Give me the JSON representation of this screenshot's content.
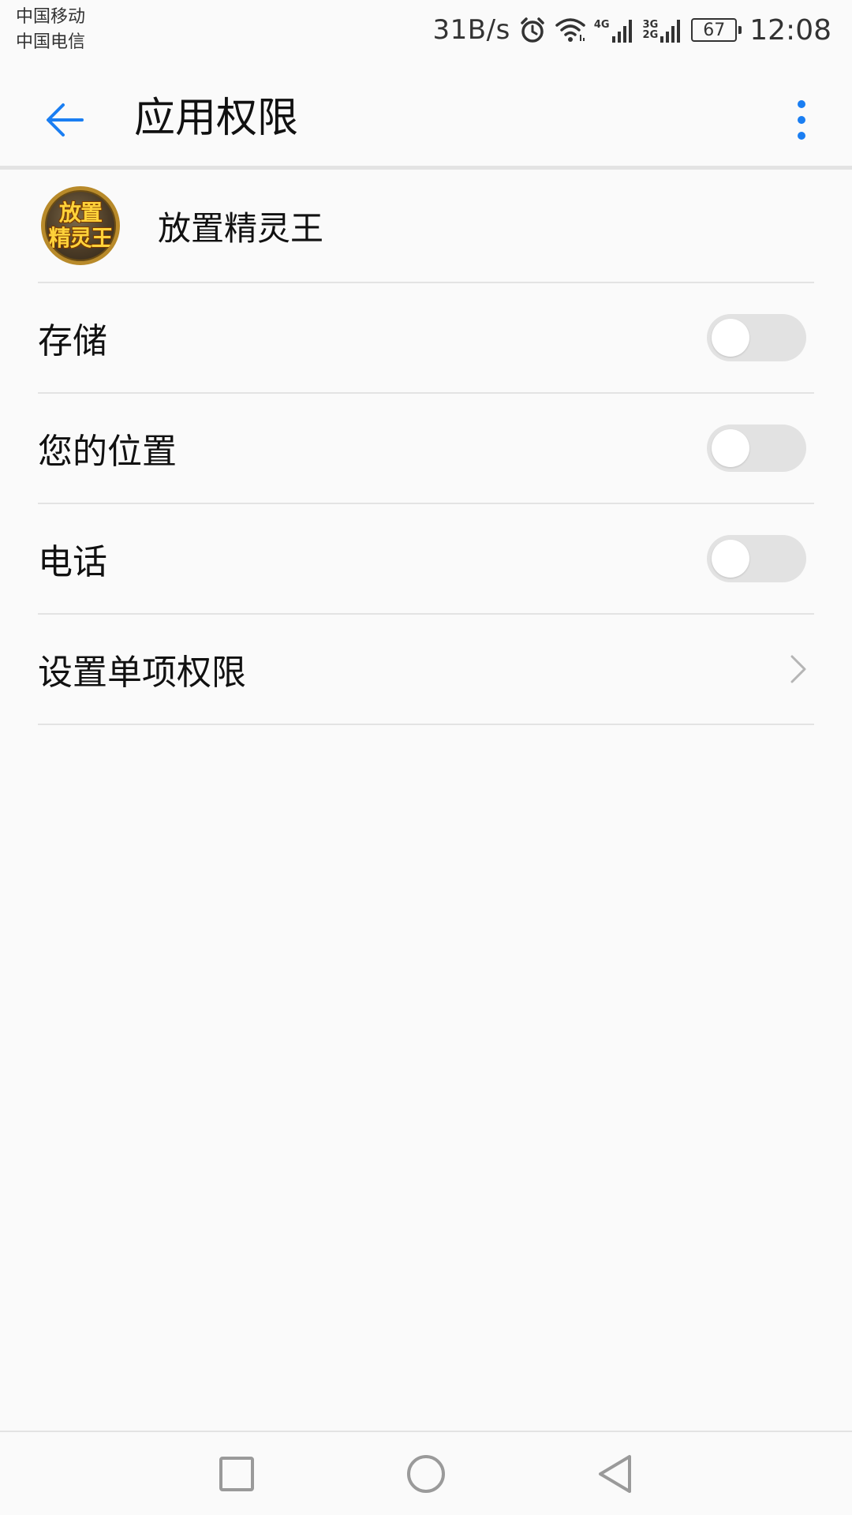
{
  "status_bar": {
    "carrier_1": "中国移动",
    "carrier_2": "中国电信",
    "net_speed": "31B/s",
    "sig1_label_top": "4G",
    "sig2_label_top": "3G",
    "sig2_label_bottom": "2G",
    "battery": "67",
    "time": "12:08",
    "icons": [
      "alarm-icon",
      "wifi-icon",
      "signal-icon",
      "signal-icon",
      "battery-icon"
    ]
  },
  "header": {
    "title": "应用权限",
    "back_icon": "arrow-left-icon",
    "more_icon": "more-vert-icon",
    "accent_color": "#1a7ef2"
  },
  "app": {
    "name": "放置精灵王",
    "logo_text_top": "放置",
    "logo_text_bottom": "精灵王"
  },
  "permissions": [
    {
      "label": "存储",
      "enabled": false
    },
    {
      "label": "您的位置",
      "enabled": false
    },
    {
      "label": "电话",
      "enabled": false
    }
  ],
  "individual_permissions": {
    "label": "设置单项权限",
    "icon": "chevron-right-icon"
  },
  "nav_bar": {
    "buttons": [
      "recents-icon",
      "home-icon",
      "back-icon"
    ]
  }
}
